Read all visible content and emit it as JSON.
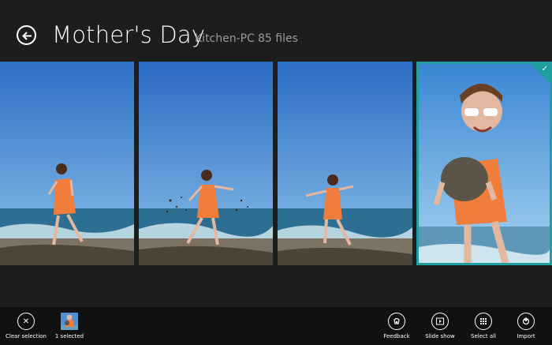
{
  "header": {
    "title": "Mother's Day",
    "source": "Kitchen-PC",
    "count": "85 files"
  },
  "photos": [
    {
      "name": "photo-1",
      "selected": false
    },
    {
      "name": "photo-2",
      "selected": false
    },
    {
      "name": "photo-3",
      "selected": false
    },
    {
      "name": "photo-4",
      "selected": true
    }
  ],
  "appbar": {
    "clear_selection": "Clear selection",
    "selected_count": "1 selected",
    "feedback": "Feedback",
    "slide_show": "Slide show",
    "select_all": "Select all",
    "import": "Import"
  },
  "icons": {
    "back": "back-arrow-icon",
    "clear": "close-icon",
    "feedback": "feedback-icon",
    "slideshow": "play-icon",
    "select_all": "grid-icon",
    "import": "import-icon",
    "check": "checkmark-icon"
  },
  "colors": {
    "background": "#1d1d1d",
    "appbar": "#111111",
    "accent": "#1f9ea0"
  }
}
